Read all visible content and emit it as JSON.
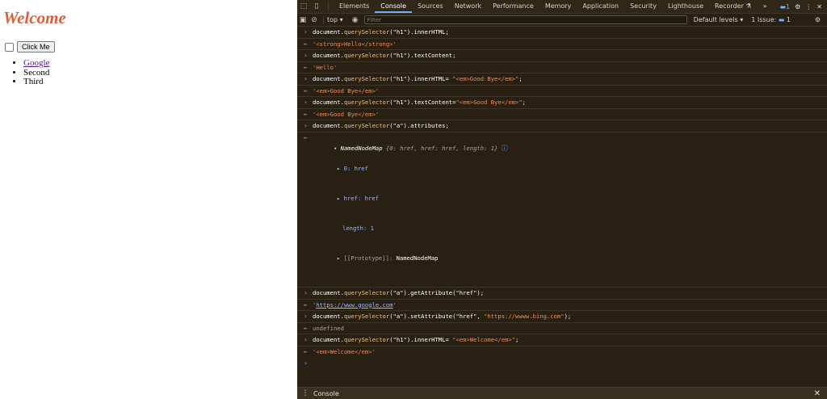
{
  "page": {
    "heading": "Welcome",
    "button_label": "Click Me",
    "list": [
      "Google",
      "Second",
      "Third"
    ]
  },
  "devtools": {
    "tabs": [
      "Elements",
      "Console",
      "Sources",
      "Network",
      "Performance",
      "Memory",
      "Application",
      "Security",
      "Lighthouse",
      "Recorder"
    ],
    "active_tab": "Console",
    "more_tabs": "»",
    "issues_badge_count": "1",
    "toolbar": {
      "context": "top",
      "filter_placeholder": "Filter",
      "levels": "Default levels",
      "issues": "1 Issue:",
      "issues_count": "1"
    },
    "console": {
      "l1_obj": "document.",
      "l1_fn": "querySelector",
      "l1_args": "(\"h1\").innerHTML;",
      "r1": "'<strong>Hello</strong>'",
      "l2_obj": "document.",
      "l2_fn": "querySelector",
      "l2_args": "(\"h1\").textContent;",
      "r2": "'Hello'",
      "l3_obj": "document.",
      "l3_fn": "querySelector",
      "l3_args": "(\"h1\").innerHTML= ",
      "l3_str": "\"<em>Good Bye</em>\"",
      "l3_end": ";",
      "r3": "'<em>Good Bye</em>'",
      "l4_obj": "document.",
      "l4_fn": "querySelector",
      "l4_args": "(\"h1\").textContent=",
      "l4_str": "\"<em>Good Bye</em>\"",
      "l4_end": ";",
      "r4": "'<em>Good Bye</em>'",
      "l5_obj": "document.",
      "l5_fn": "querySelector",
      "l5_args": "(\"a\").attributes;",
      "nnm_title": "NamedNodeMap",
      "nnm_preview": "{0: href, href: href, length: 1}",
      "nnm_0": "0: href",
      "nnm_href": "href: href",
      "nnm_length": "length: 1",
      "nnm_proto_key": "[[Prototype]]: ",
      "nnm_proto_val": "NamedNodeMap",
      "l6_obj": "document.",
      "l6_fn": "querySelector",
      "l6_args": "(\"a\").getAttribute(\"href\");",
      "r6_q1": "'",
      "r6_link": "https://www.google.com",
      "r6_q2": "'",
      "l7_obj": "document.",
      "l7_fn": "querySelector",
      "l7_args": "(\"a\").setAttribute(\"href\", ",
      "l7_str": "\"https://wwww.bing.com\"",
      "l7_end": ");",
      "r7": "undefined",
      "l8_obj": "document.",
      "l8_fn": "querySelector",
      "l8_args": "(\"h1\").innerHTML= ",
      "l8_str": "\"<em>Welcome</em>\"",
      "l8_end": ";",
      "r8": "'<em>Welcome</em>'"
    },
    "drawer_label": "Console"
  }
}
